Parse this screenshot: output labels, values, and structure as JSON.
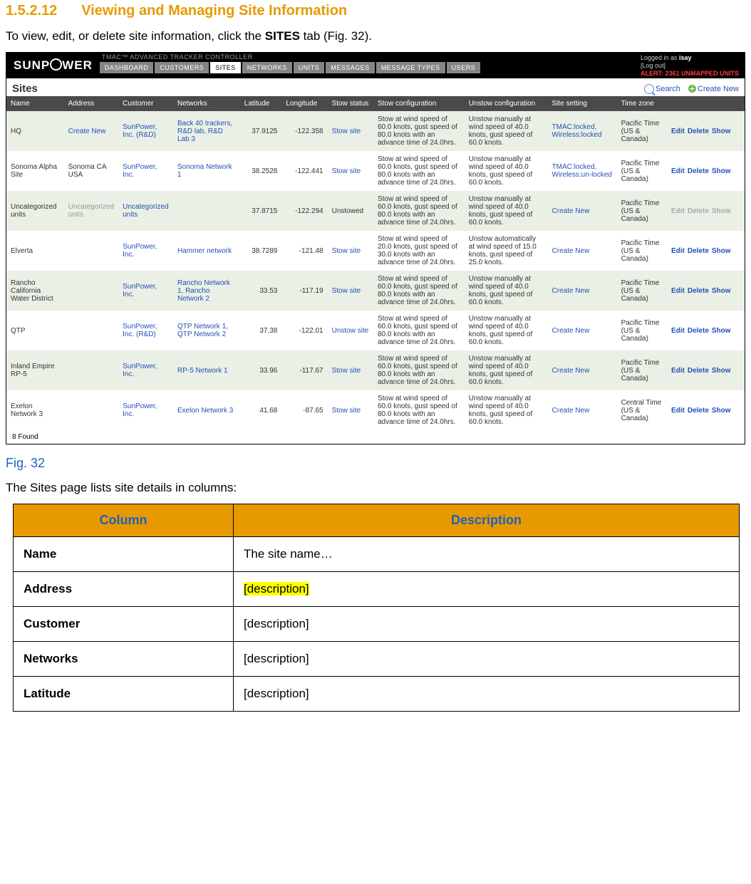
{
  "heading": {
    "num": "1.5.2.12",
    "title": "Viewing and Managing Site Information"
  },
  "intro": {
    "pre": "To view, edit, or delete site information, click the ",
    "bold": "SITES",
    "post": " tab (Fig. 32)."
  },
  "app": {
    "logo_left": "SUNP",
    "logo_right": "WER",
    "tmac": "TMAC™ ADVANCED TRACKER CONTROLLER",
    "tabs": [
      "DASHBOARD",
      "CUSTOMERS",
      "SITES",
      "NETWORKS",
      "UNITS",
      "MESSAGES",
      "MESSAGE TYPES",
      "USERS"
    ],
    "active_tab_index": 2,
    "user_line1_pre": "Logged in as ",
    "user_line1_bold": "isay",
    "user_line2": "[Log out]",
    "alert": "ALERT: 2361 UNMAPPED UNITS"
  },
  "sitesbar": {
    "title": "Sites",
    "search": "Search",
    "create": "Create New"
  },
  "cols": [
    "Name",
    "Address",
    "Customer",
    "Networks",
    "Latitude",
    "Longitude",
    "Stow status",
    "Stow configuration",
    "Unstow configuration",
    "Site setting",
    "Time zone",
    ""
  ],
  "rows": [
    {
      "name": "HQ",
      "addr": "Create New",
      "addr_link": true,
      "cust": "SunPower, Inc. (R&D)",
      "net": "Back 40 trackers, R&D lab, R&D Lab 3",
      "lat": "37.9125",
      "lon": "-122.358",
      "stow": "Stow site",
      "conf": "Stow at wind speed of 60.0 knots, gust speed of 80.0 knots with an advance time of 24.0hrs.",
      "unconf": "Unstow manually at wind speed of 40.0 knots, gust speed of 60.0 knots.",
      "set": "TMAC:locked, Wireless:locked",
      "tz": "Pacific Time (US & Canada)",
      "disabled": false
    },
    {
      "name": "Sonoma Alpha Site",
      "addr": "Sonoma CA USA",
      "addr_link": false,
      "cust": "SunPower, Inc.",
      "net": "Sonoma Network 1",
      "lat": "38.2528",
      "lon": "-122.441",
      "stow": "Stow site",
      "conf": "Stow at wind speed of 60.0 knots, gust speed of 80.0 knots with an advance time of 24.0hrs.",
      "unconf": "Unstow manually at wind speed of 40.0 knots, gust speed of 60.0 knots.",
      "set": "TMAC:locked, Wireless:un-locked",
      "tz": "Pacific Time (US & Canada)",
      "disabled": false
    },
    {
      "name": "Uncategorized units",
      "addr": "Uncategorized units",
      "addr_link": false,
      "addr_muted": true,
      "cust": "Uncategorized units",
      "net": "",
      "lat": "37.8715",
      "lon": "-122.294",
      "stow": "Unstowed",
      "stow_plain": true,
      "conf": "Stow at wind speed of 60.0 knots, gust speed of 80.0 knots with an advance time of 24.0hrs.",
      "unconf": "Unstow manually at wind speed of 40.0 knots, gust speed of 60.0 knots.",
      "set": "Create New",
      "tz": "Pacific Time (US & Canada)",
      "disabled": true
    },
    {
      "name": "Elverta",
      "addr": "",
      "addr_link": false,
      "cust": "SunPower, Inc.",
      "net": "Hammer network",
      "lat": "38.7289",
      "lon": "-121.48",
      "stow": "Stow site",
      "conf": "Stow at wind speed of 20.0 knots, gust speed of 30.0 knots with an advance time of 24.0hrs.",
      "unconf": "Unstow automatically at wind speed of 15.0 knots, gust speed of 25.0 knots.",
      "set": "Create New",
      "tz": "Pacific Time (US & Canada)",
      "disabled": false
    },
    {
      "name": "Rancho California Water District",
      "addr": "",
      "addr_link": false,
      "cust": "SunPower, Inc.",
      "net": "Rancho Network 1, Rancho Network 2",
      "lat": "33.53",
      "lon": "-117.19",
      "stow": "Stow site",
      "conf": "Stow at wind speed of 60.0 knots, gust speed of 80.0 knots with an advance time of 24.0hrs.",
      "unconf": "Unstow manually at wind speed of 40.0 knots, gust speed of 60.0 knots.",
      "set": "Create New",
      "tz": "Pacific Time (US & Canada)",
      "disabled": false
    },
    {
      "name": "QTP",
      "addr": "",
      "addr_link": false,
      "cust": "SunPower, Inc. (R&D)",
      "net": "QTP Network 1, QTP Network 2",
      "lat": "37.38",
      "lon": "-122.01",
      "stow": "Unstow site",
      "conf": "Stow at wind speed of 60.0 knots, gust speed of 80.0 knots with an advance time of 24.0hrs.",
      "unconf": "Unstow manually at wind speed of 40.0 knots, gust speed of 60.0 knots.",
      "set": "Create New",
      "tz": "Pacific Time (US & Canada)",
      "disabled": false
    },
    {
      "name": "Inland Empire RP-5",
      "addr": "",
      "addr_link": false,
      "cust": "SunPower, Inc.",
      "net": "RP-5 Network 1",
      "lat": "33.96",
      "lon": "-117.67",
      "stow": "Stow site",
      "conf": "Stow at wind speed of 60.0 knots, gust speed of 80.0 knots with an advance time of 24.0hrs.",
      "unconf": "Unstow manually at wind speed of 40.0 knots, gust speed of 60.0 knots.",
      "set": "Create New",
      "tz": "Pacific Time (US & Canada)",
      "disabled": false
    },
    {
      "name": "Exelon Network 3",
      "addr": "",
      "addr_link": false,
      "cust": "SunPower, Inc.",
      "net": "Exelon Network 3",
      "lat": "41.68",
      "lon": "-87.65",
      "stow": "Stow site",
      "conf": "Stow at wind speed of 60.0 knots, gust speed of 80.0 knots with an advance time of 24.0hrs.",
      "unconf": "Unstow manually at wind speed of 40.0 knots, gust speed of 60.0 knots.",
      "set": "Create New",
      "tz": "Central Time (US & Canada)",
      "disabled": false
    }
  ],
  "actions": {
    "edit": "Edit",
    "delete": "Delete",
    "show": "Show"
  },
  "found": "8 Found",
  "figcap": "Fig. 32",
  "after_fig": "The Sites page lists site details in columns:",
  "desc_head": {
    "c1": "Column",
    "c2": "Description"
  },
  "desc_rows": [
    {
      "col": "Name",
      "desc": "The site name…",
      "hl": false
    },
    {
      "col": "Address",
      "desc": "[description]",
      "hl": true
    },
    {
      "col": "Customer",
      "desc": "[description]",
      "hl": false
    },
    {
      "col": "Networks",
      "desc": "[description]",
      "hl": false
    },
    {
      "col": "Latitude",
      "desc": "[description]",
      "hl": false
    }
  ]
}
